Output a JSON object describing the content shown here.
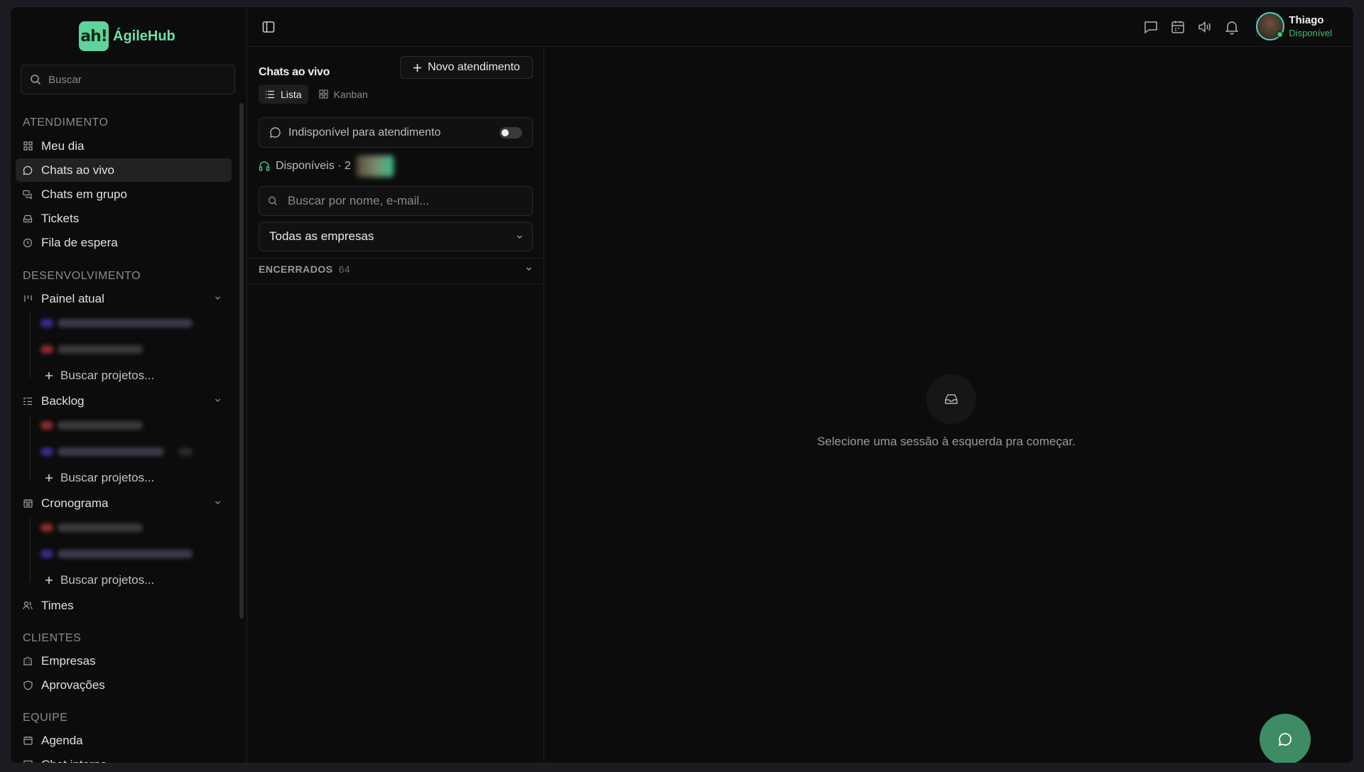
{
  "brand": {
    "logo_mark": "ah!",
    "name": "ÁgileHub"
  },
  "sidebar": {
    "search_placeholder": "Buscar",
    "sections": {
      "atendimento": "ATENDIMENTO",
      "desenvolvimento": "DESENVOLVIMENTO",
      "clientes": "CLIENTES",
      "equipe": "EQUIPE"
    },
    "items": {
      "meu_dia": "Meu dia",
      "chats_ao_vivo": "Chats ao vivo",
      "chats_em_grupo": "Chats em grupo",
      "tickets": "Tickets",
      "fila_de_espera": "Fila de espera",
      "painel_atual": "Painel atual",
      "backlog": "Backlog",
      "cronograma": "Cronograma",
      "times": "Times",
      "empresas": "Empresas",
      "aprovacoes": "Aprovações",
      "agenda": "Agenda",
      "chat_interno": "Chat interno"
    },
    "add_project_label": "Buscar projetos..."
  },
  "header": {
    "user_name": "Thiago",
    "user_status": "Disponível"
  },
  "chats_panel": {
    "title": "Chats ao vivo",
    "new_button": "Novo atendimento",
    "tabs": {
      "list": "Lista",
      "kanban": "Kanban"
    },
    "availability_toggle_label": "Indisponível para atendimento",
    "available_label": "Disponíveis · 2",
    "search_placeholder": "Buscar por nome, e-mail...",
    "company_filter": "Todas as empresas",
    "closed_group": {
      "label": "ENCERRADOS",
      "count": "64"
    }
  },
  "main": {
    "empty_message": "Selecione uma sessão à esquerda pra começar."
  },
  "colors": {
    "accent": "#3e8c63",
    "brand_green": "#6ee0a4",
    "status_online": "#3fbf6f"
  }
}
